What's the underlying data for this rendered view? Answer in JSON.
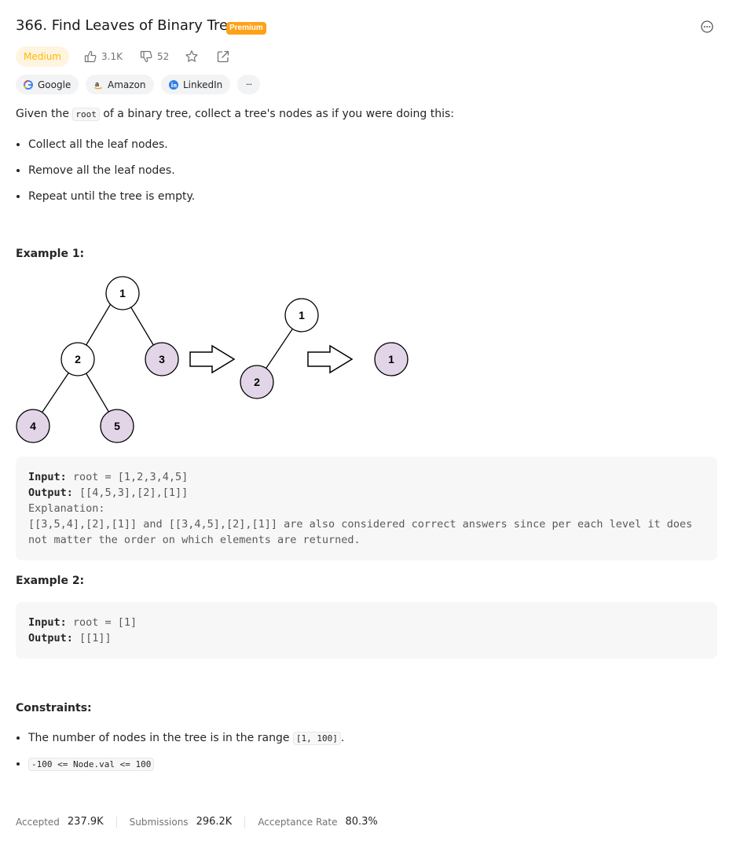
{
  "header": {
    "title": "366. Find Leaves of Binary Tree",
    "premium_label": "Premium",
    "difficulty": "Medium",
    "likes": "3.1K",
    "dislikes": "52"
  },
  "companies": [
    "Google",
    "Amazon",
    "LinkedIn",
    "···"
  ],
  "description": {
    "intro_before": "Given the ",
    "intro_code": "root",
    "intro_after": " of a binary tree, collect a tree's nodes as if you were doing this:",
    "steps": [
      "Collect all the leaf nodes.",
      "Remove all the leaf nodes.",
      "Repeat until the tree is empty."
    ]
  },
  "example1": {
    "heading": "Example 1:",
    "tree_labels": {
      "a1": "1",
      "a2": "2",
      "a3": "3",
      "a4": "4",
      "a5": "5",
      "b1": "1",
      "b2": "2",
      "c1": "1"
    },
    "input_label": "Input:",
    "input_value": " root = [1,2,3,4,5]",
    "output_label": "Output:",
    "output_value": " [[4,5,3],[2],[1]]",
    "explanation_label": "Explanation:",
    "explanation_line1": "[[3,5,4],[2],[1]] and [[3,4,5],[2],[1]] are also considered correct answers since per each level it does",
    "explanation_line2": "not matter the order on which elements are returned."
  },
  "example2": {
    "heading": "Example 2:",
    "input_label": "Input:",
    "input_value": " root = [1]",
    "output_label": "Output:",
    "output_value": " [[1]]"
  },
  "constraints": {
    "heading": "Constraints:",
    "c1_before": "The number of nodes in the tree is in the range ",
    "c1_code": "[1, 100]",
    "c1_after": ".",
    "c2_code": "-100 <= Node.val <= 100"
  },
  "footer": {
    "accepted_label": "Accepted",
    "accepted_value": "237.9K",
    "submissions_label": "Submissions",
    "submissions_value": "296.2K",
    "rate_label": "Acceptance Rate",
    "rate_value": "80.3%"
  },
  "colors": {
    "accent": "#ffa116",
    "medium": "#ffb800",
    "leaf_fill": "#e1d5e7"
  }
}
